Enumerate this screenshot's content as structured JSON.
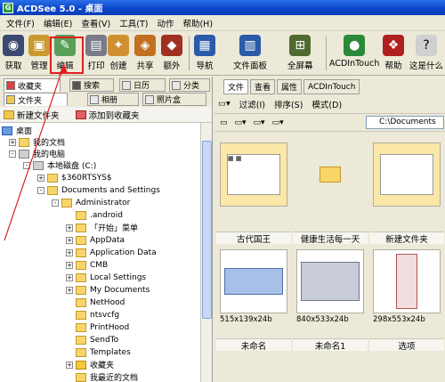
{
  "title": "ACDSee 5.0 - 桌面",
  "menu": [
    "文件(F)",
    "编辑(E)",
    "查看(V)",
    "工具(T)",
    "动作",
    "帮助(H)"
  ],
  "toolbar": [
    "获取",
    "管理",
    "编辑",
    "打印",
    "创建",
    "共享",
    "额外",
    "导航",
    "文件面板",
    "全屏幕",
    "ACDInTouch",
    "帮助",
    "这是什么"
  ],
  "left_tabs": [
    "收藏夹",
    "搜索",
    "日历",
    "分类",
    "文件夹",
    "相册",
    "照片盒"
  ],
  "left_bar": [
    "新建文件夹",
    "添加到收藏夹"
  ],
  "tree": [
    "桌面",
    "我的文档",
    "我的电脑",
    "本地磁盘 (C:)",
    "$360RTSYS$",
    "Documents and Settings",
    "Administrator",
    ".android",
    "「开始」菜单",
    "AppData",
    "Application Data",
    "CMB",
    "Local Settings",
    "My Documents",
    "NetHood",
    "ntsvcfg",
    "PrintHood",
    "SendTo",
    "Templates",
    "收藏夹",
    "我最近的文档"
  ],
  "right_tabs": [
    "文件",
    "查看",
    "属性",
    "ACDInTouch"
  ],
  "right_toolbar": [
    "过滤(I)",
    "排序(S)",
    "模式(D)"
  ],
  "path": "C:\\Documents",
  "grid": [
    {
      "caption": "古代国王",
      "info": ""
    },
    {
      "caption": "健康生活每一天",
      "info": ""
    },
    {
      "caption": "新建文件夹",
      "info": ""
    },
    {
      "caption": "未命名",
      "info": "515x139x24b"
    },
    {
      "caption": "未命名1",
      "info": "840x533x24b"
    },
    {
      "caption": "选项",
      "info": "298x553x24b"
    }
  ]
}
